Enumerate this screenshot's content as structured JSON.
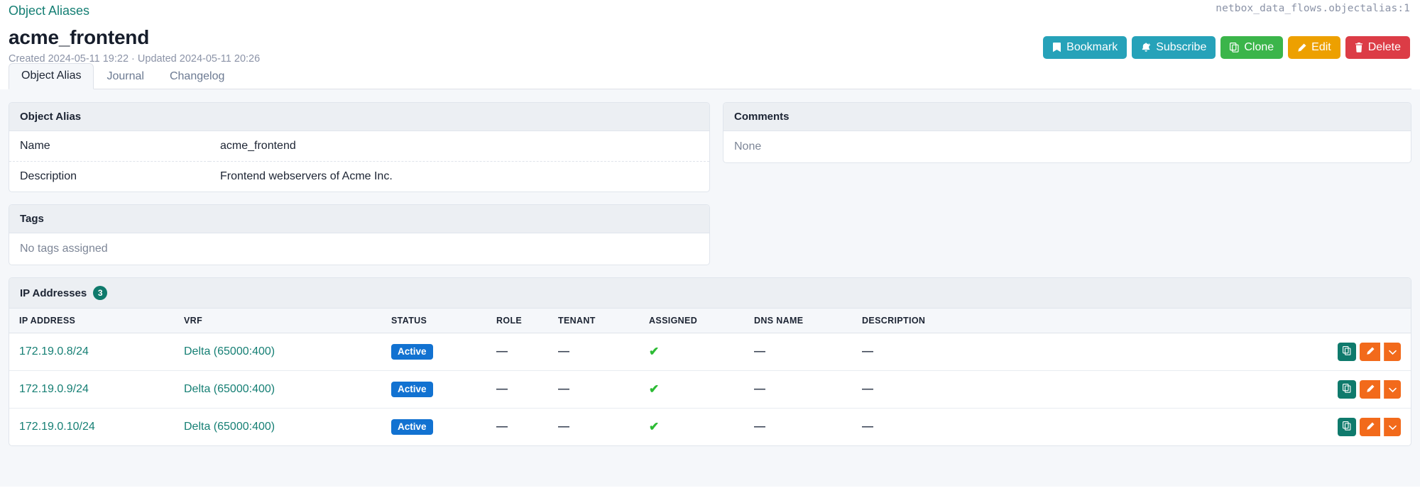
{
  "header": {
    "breadcrumb": "Object Aliases",
    "object_ref": "netbox_data_flows.objectalias:1",
    "title": "acme_frontend",
    "meta": "Created 2024-05-11 19:22 · Updated 2024-05-11 20:26",
    "buttons": [
      {
        "label": "Bookmark",
        "icon": "bookmark-icon",
        "color": "#26a2b9"
      },
      {
        "label": "Subscribe",
        "icon": "bell-plus-icon",
        "color": "#26a2b9"
      },
      {
        "label": "Clone",
        "icon": "copy-icon",
        "color": "#3bb54a"
      },
      {
        "label": "Edit",
        "icon": "pencil-icon",
        "color": "#eda000"
      },
      {
        "label": "Delete",
        "icon": "trash-icon",
        "color": "#dc3c46"
      }
    ]
  },
  "tabs": [
    {
      "label": "Object Alias",
      "active": true
    },
    {
      "label": "Journal",
      "active": false
    },
    {
      "label": "Changelog",
      "active": false
    }
  ],
  "object_alias_card": {
    "title": "Object Alias",
    "rows": [
      {
        "key": "Name",
        "value": "acme_frontend"
      },
      {
        "key": "Description",
        "value": "Frontend webservers of Acme Inc."
      }
    ]
  },
  "comments_card": {
    "title": "Comments",
    "empty_text": "None"
  },
  "tags_card": {
    "title": "Tags",
    "empty_text": "No tags assigned"
  },
  "ip_addresses": {
    "title": "IP Addresses",
    "count": "3",
    "columns": [
      "IP ADDRESS",
      "VRF",
      "STATUS",
      "ROLE",
      "TENANT",
      "ASSIGNED",
      "DNS NAME",
      "DESCRIPTION",
      ""
    ],
    "rows": [
      {
        "ip": "172.19.0.8/24",
        "vrf": "Delta (65000:400)",
        "status": "Active",
        "role": "—",
        "tenant": "—",
        "assigned": "✔",
        "dns_name": "—",
        "description": "—"
      },
      {
        "ip": "172.19.0.9/24",
        "vrf": "Delta (65000:400)",
        "status": "Active",
        "role": "—",
        "tenant": "—",
        "assigned": "✔",
        "dns_name": "—",
        "description": "—"
      },
      {
        "ip": "172.19.0.10/24",
        "vrf": "Delta (65000:400)",
        "status": "Active",
        "role": "—",
        "tenant": "—",
        "assigned": "✔",
        "dns_name": "—",
        "description": "—"
      }
    ]
  },
  "colors": {
    "link_teal": "#157f74",
    "status_blue": "#1272d1",
    "badge_green": "#0f7a6c",
    "check_green": "#2cbb34",
    "action_orange": "#f26a1b"
  }
}
